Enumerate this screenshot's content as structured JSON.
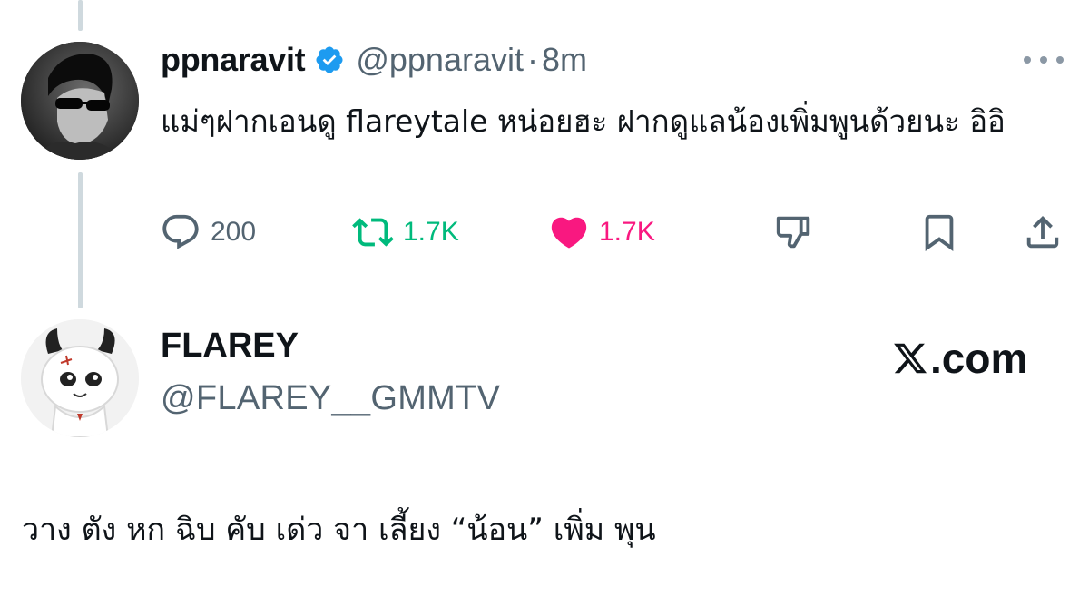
{
  "colors": {
    "verified": "#1d9bf0",
    "retweet_green": "#00ba7c",
    "like_pink": "#f91880",
    "muted_gray": "#536471",
    "thread_line": "#cfd9de"
  },
  "parent_tweet": {
    "display_name": "ppnaravit",
    "handle": "@ppnaravit",
    "separator": "·",
    "time": "8m",
    "text": "แม่ๆฝากเอนดู flareytale หน่อยฮะ ฝากดูแลน้องเพิ่มพูนด้วยนะ อิอิ",
    "replies": "200",
    "retweets": "1.7K",
    "likes": "1.7K",
    "icons": [
      "reply-icon",
      "retweet-icon",
      "like-icon",
      "dislike-icon",
      "bookmark-icon",
      "share-icon",
      "more-icon",
      "verified-icon"
    ]
  },
  "reply_tweet": {
    "display_name": "FLAREY",
    "handle": "@FLAREY__GMMTV",
    "brand": ".com",
    "brand_icon": "x-logo-icon",
    "text": "วาง ตัง หก ฉิบ คับ เด่ว จา เลี้ยง “น้อน” เพิ่ม พุน"
  }
}
